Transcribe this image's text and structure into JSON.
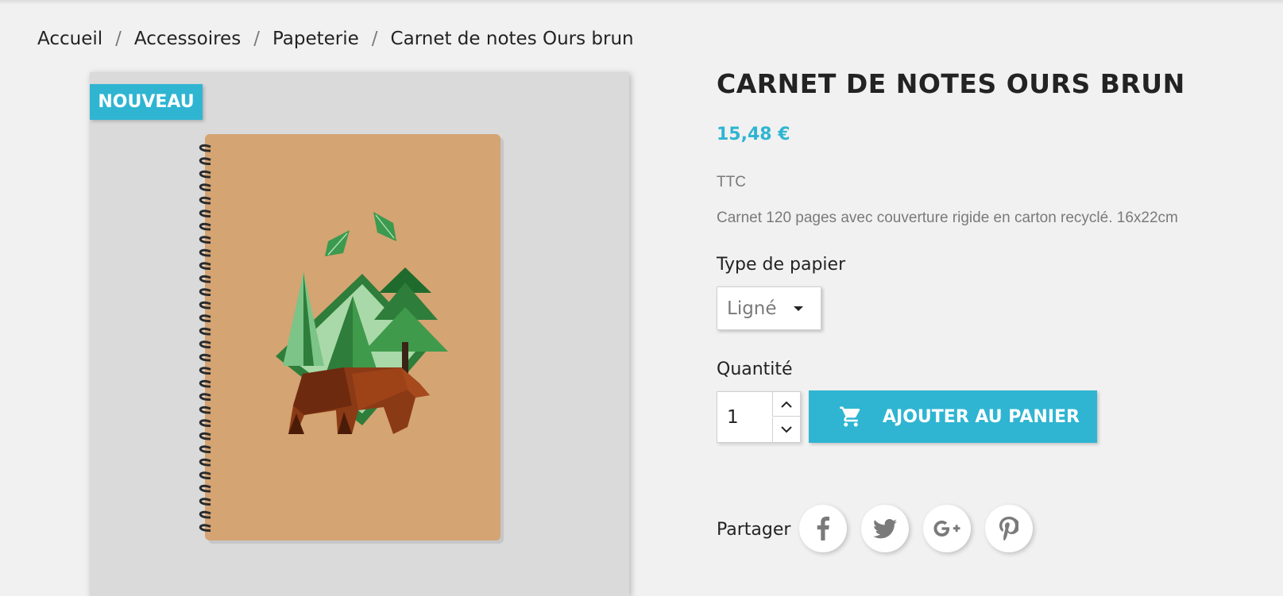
{
  "breadcrumb": {
    "items": [
      "Accueil",
      "Accessoires",
      "Papeterie",
      "Carnet de notes Ours brun"
    ],
    "separator": "/"
  },
  "product": {
    "badge": "NOUVEAU",
    "title": "CARNET DE NOTES OURS BRUN",
    "price": "15,48 €",
    "tax_label": "TTC",
    "description": "Carnet 120 pages avec couverture rigide en carton recyclé. 16x22cm",
    "image_icon": "notebook-bear-image"
  },
  "variant": {
    "label": "Type de papier",
    "selected": "Ligné"
  },
  "quantity": {
    "label": "Quantité",
    "value": "1"
  },
  "add_to_cart": {
    "label": "AJOUTER AU PANIER",
    "icon": "cart-icon"
  },
  "share": {
    "label": "Partager",
    "networks": [
      "facebook",
      "twitter",
      "google-plus",
      "pinterest"
    ]
  },
  "colors": {
    "accent": "#2fb5d2",
    "background": "#f1f1f1",
    "text": "#232323",
    "muted": "#7a7a7a"
  }
}
